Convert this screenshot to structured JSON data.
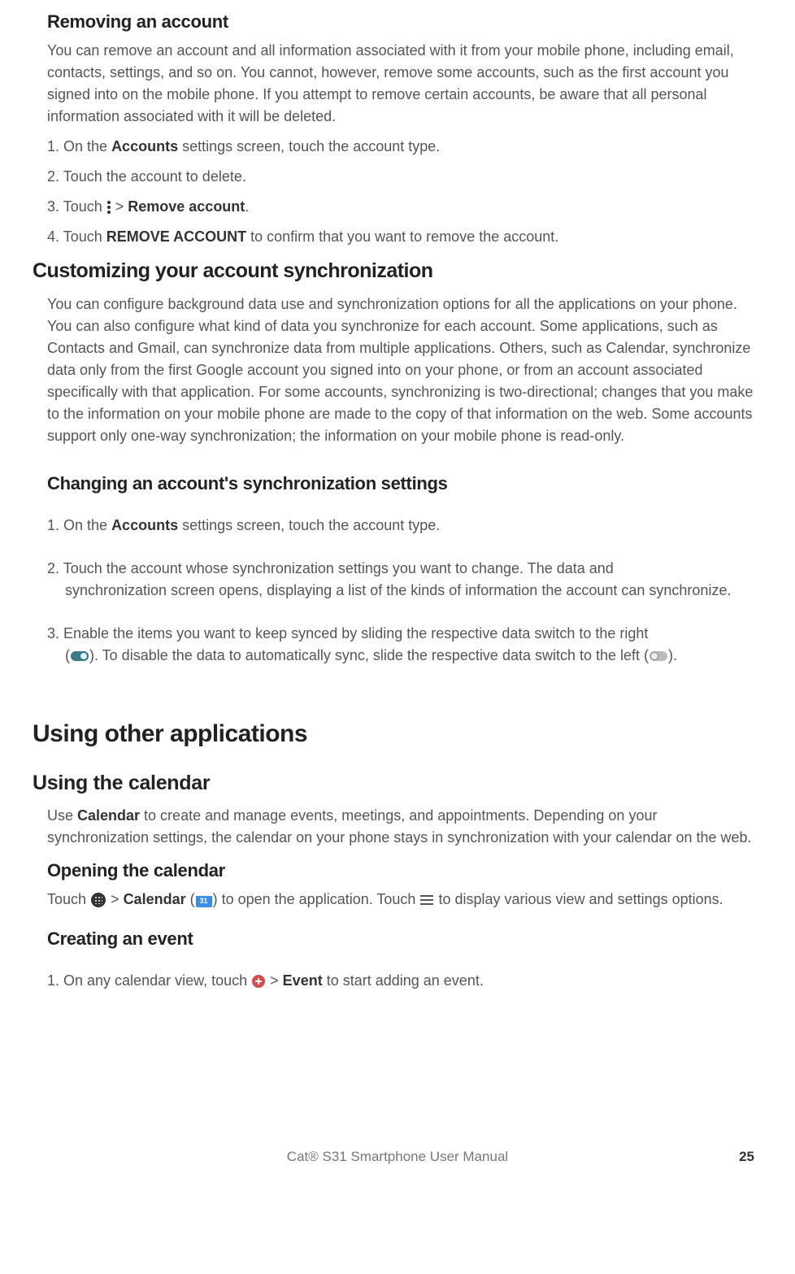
{
  "s1": {
    "title": "Removing an account",
    "intro": "You can remove an account and all information associated with it from your mobile phone, including email, contacts, settings, and so on. You cannot, however, remove some accounts, such as the first account you signed into on the mobile phone. If you attempt to remove certain accounts, be aware that all personal information associated with it will be deleted.",
    "step1_a": "1. On the ",
    "step1_b": "Accounts",
    "step1_c": " settings screen, touch the account type.",
    "step2": "2. Touch the account to delete.",
    "step3_a": "3. Touch ",
    "step3_b": " > ",
    "step3_c": "Remove account",
    "step3_d": ".",
    "step4_a": "4. Touch ",
    "step4_b": "REMOVE ACCOUNT",
    "step4_c": " to confirm that you want to remove the account."
  },
  "s2": {
    "title": "Customizing your account synchronization",
    "intro": "You can configure background data use and synchronization options for all the applications on your phone. You can also configure what kind of data you synchronize for each account. Some applications, such as Contacts and Gmail, can synchronize data from multiple applications. Others, such as Calendar, synchronize data only from the first Google account you signed into on your phone, or from an account associated specifically with that application. For some accounts, synchronizing is two-directional; changes that you make to the information on your mobile phone are made to the copy of that information on the web. Some accounts support only one-way synchronization; the information on your mobile phone is read-only."
  },
  "s3": {
    "title": "Changing an account's synchronization settings",
    "step1_a": "1. On the ",
    "step1_b": "Accounts",
    "step1_c": " settings screen, touch the account type.",
    "step2_a": "2. Touch the account whose synchronization settings you want to change. The data and ",
    "step2_b": "synchronization screen opens, displaying a list of the kinds of information the account can synchronize.",
    "step3_a": "3. Enable the items you want to keep synced by sliding the respective data switch to the right ",
    "step3_b": "(",
    "step3_c": "). To disable the data to automatically sync, slide the respective data switch to the left (",
    "step3_d": ")."
  },
  "s4": {
    "title": "Using other applications"
  },
  "s5": {
    "title": "Using the calendar",
    "intro_a": "Use ",
    "intro_b": "Calendar",
    "intro_c": " to create and manage events, meetings, and appointments. Depending on your synchronization settings, the calendar on your phone stays in synchronization with your calendar on the web."
  },
  "s6": {
    "title": "Opening the calendar",
    "p_a": "Touch ",
    "p_b": " > ",
    "p_c": "Calendar",
    "p_d": " (",
    "p_e": ") to open the application. Touch ",
    "p_f": " to display various view and settings options.",
    "cal_icon_text": "31"
  },
  "s7": {
    "title": "Creating an event",
    "step1_a": "1. On any calendar view, touch ",
    "step1_b": " > ",
    "step1_c": "Event",
    "step1_d": " to start adding an event."
  },
  "footer": {
    "title": "Cat® S31 Smartphone User Manual",
    "page": "25"
  }
}
